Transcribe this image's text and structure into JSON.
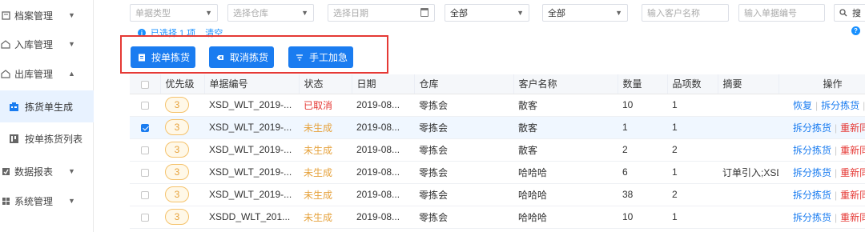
{
  "sidebar": {
    "items": [
      {
        "label": "档案管理",
        "icon": "archive-icon",
        "arrow": "▼"
      },
      {
        "label": "入库管理",
        "icon": "inbound-icon",
        "arrow": "▼"
      },
      {
        "label": "出库管理",
        "icon": "outbound-icon",
        "arrow": "▲"
      },
      {
        "label": "数据报表",
        "icon": "report-icon",
        "arrow": "▼"
      },
      {
        "label": "系统管理",
        "icon": "system-icon",
        "arrow": "▼"
      }
    ],
    "sub": [
      {
        "label": "拣货单生成",
        "icon": "pick-generate-icon",
        "active": true
      },
      {
        "label": "按单拣货列表",
        "icon": "pick-list-icon",
        "active": false
      }
    ]
  },
  "filters": {
    "doc_type": "单据类型",
    "warehouse": "选择仓库",
    "date": "选择日期",
    "status1": "全部",
    "status2": "全部",
    "customer": "输入客户名称",
    "doc_no": "输入单据编号",
    "search_btn": "搜"
  },
  "selection": {
    "info": "已选择 1 项",
    "clear": "清空"
  },
  "toolbar": {
    "pick_by_order": "按单拣货",
    "cancel_pick": "取消拣货",
    "manual_urgent": "手工加急"
  },
  "table": {
    "headers": [
      "优先级",
      "单据编号",
      "状态",
      "日期",
      "仓库",
      "客户名称",
      "数量",
      "品项数",
      "摘要",
      "操作"
    ],
    "rows": [
      {
        "checked": false,
        "priority": "3",
        "doc_no": "XSD_WLT_2019-...",
        "status": "已取消",
        "status_color": "#e53935",
        "date": "2019-08...",
        "warehouse": "零拣会",
        "customer": "散客",
        "qty": "10",
        "items": "1",
        "summary": "",
        "ops": [
          "恢复",
          "拆分拣货"
        ]
      },
      {
        "checked": true,
        "priority": "3",
        "doc_no": "XSD_WLT_2019-...",
        "status": "未生成",
        "status_color": "#e6a23c",
        "date": "2019-08...",
        "warehouse": "零拣会",
        "customer": "散客",
        "qty": "1",
        "items": "1",
        "summary": "",
        "ops": [
          "拆分拣货",
          "重新同"
        ]
      },
      {
        "checked": false,
        "priority": "3",
        "doc_no": "XSD_WLT_2019-...",
        "status": "未生成",
        "status_color": "#e6a23c",
        "date": "2019-08...",
        "warehouse": "零拣会",
        "customer": "散客",
        "qty": "2",
        "items": "2",
        "summary": "",
        "ops": [
          "拆分拣货",
          "重新同"
        ]
      },
      {
        "checked": false,
        "priority": "3",
        "doc_no": "XSD_WLT_2019-...",
        "status": "未生成",
        "status_color": "#e6a23c",
        "date": "2019-08...",
        "warehouse": "零拣会",
        "customer": "哈哈哈",
        "qty": "6",
        "items": "1",
        "summary": "订单引入;XSD",
        "ops": [
          "拆分拣货",
          "重新同"
        ]
      },
      {
        "checked": false,
        "priority": "3",
        "doc_no": "XSD_WLT_2019-...",
        "status": "未生成",
        "status_color": "#e6a23c",
        "date": "2019-08...",
        "warehouse": "零拣会",
        "customer": "哈哈哈",
        "qty": "38",
        "items": "2",
        "summary": "",
        "ops": [
          "拆分拣货",
          "重新同"
        ]
      },
      {
        "checked": false,
        "priority": "3",
        "doc_no": "XSDD_WLT_201...",
        "status": "未生成",
        "status_color": "#e6a23c",
        "date": "2019-08...",
        "warehouse": "零拣会",
        "customer": "哈哈哈",
        "qty": "10",
        "items": "1",
        "summary": "",
        "ops": [
          "拆分拣货",
          "重新同"
        ]
      }
    ]
  },
  "colors": {
    "accent": "#1a7cf0",
    "highlight": "#e53935",
    "cancelled": "#e53935",
    "pending": "#e6a23c"
  }
}
